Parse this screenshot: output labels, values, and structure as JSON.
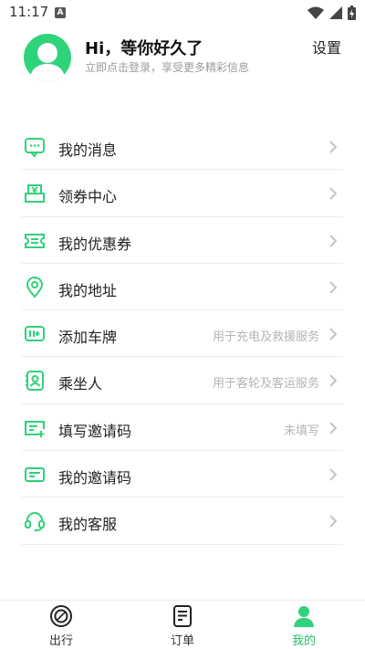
{
  "status_bar": {
    "time": "11:17",
    "notif_letter": "A"
  },
  "profile": {
    "greeting": "Hi，等你好久了",
    "subtitle": "立即点击登录，享受更多精彩信息",
    "settings_label": "设置"
  },
  "menu": {
    "items": [
      {
        "label": "我的消息",
        "hint": ""
      },
      {
        "label": "领券中心",
        "hint": ""
      },
      {
        "label": "我的优惠券",
        "hint": ""
      },
      {
        "label": "我的地址",
        "hint": ""
      },
      {
        "label": "添加车牌",
        "hint": "用于充电及救援服务"
      },
      {
        "label": "乘坐人",
        "hint": "用于客轮及客运服务"
      },
      {
        "label": "填写邀请码",
        "hint": "未填写"
      },
      {
        "label": "我的邀请码",
        "hint": ""
      },
      {
        "label": "我的客服",
        "hint": ""
      }
    ]
  },
  "bottom_nav": {
    "items": [
      {
        "label": "出行"
      },
      {
        "label": "订单"
      },
      {
        "label": "我的"
      }
    ]
  },
  "colors": {
    "accent": "#2ed37a",
    "accent_text": "#1fbe66"
  }
}
